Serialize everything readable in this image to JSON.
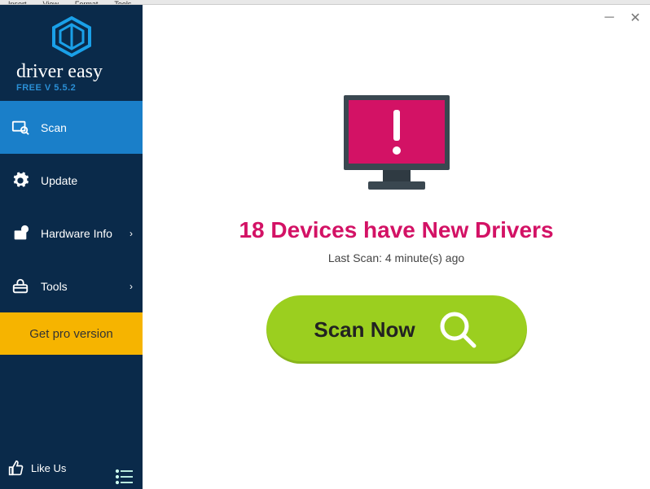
{
  "topbar": {
    "items": [
      "Insert",
      "View",
      "Format",
      "Tools"
    ]
  },
  "brand": {
    "name": "driver easy",
    "version_line": "FREE V 5.5.2"
  },
  "sidebar": {
    "items": [
      {
        "label": "Scan",
        "icon": "scan-icon",
        "active": true,
        "chevron": false
      },
      {
        "label": "Update",
        "icon": "gear-icon",
        "active": false,
        "chevron": false
      },
      {
        "label": "Hardware Info",
        "icon": "chip-icon",
        "active": false,
        "chevron": true
      },
      {
        "label": "Tools",
        "icon": "toolbox-icon",
        "active": false,
        "chevron": true
      }
    ],
    "pro_label": "Get pro version"
  },
  "bottom": {
    "like_label": "Like Us"
  },
  "main": {
    "headline": "18 Devices have New Drivers",
    "last_scan": "Last Scan: 4 minute(s) ago",
    "scan_button": "Scan Now"
  },
  "colors": {
    "accent": "#d31265",
    "green": "#9bcf1f",
    "sidebar": "#0a2a4a",
    "active": "#1a7fc9",
    "pro": "#f6b400"
  }
}
